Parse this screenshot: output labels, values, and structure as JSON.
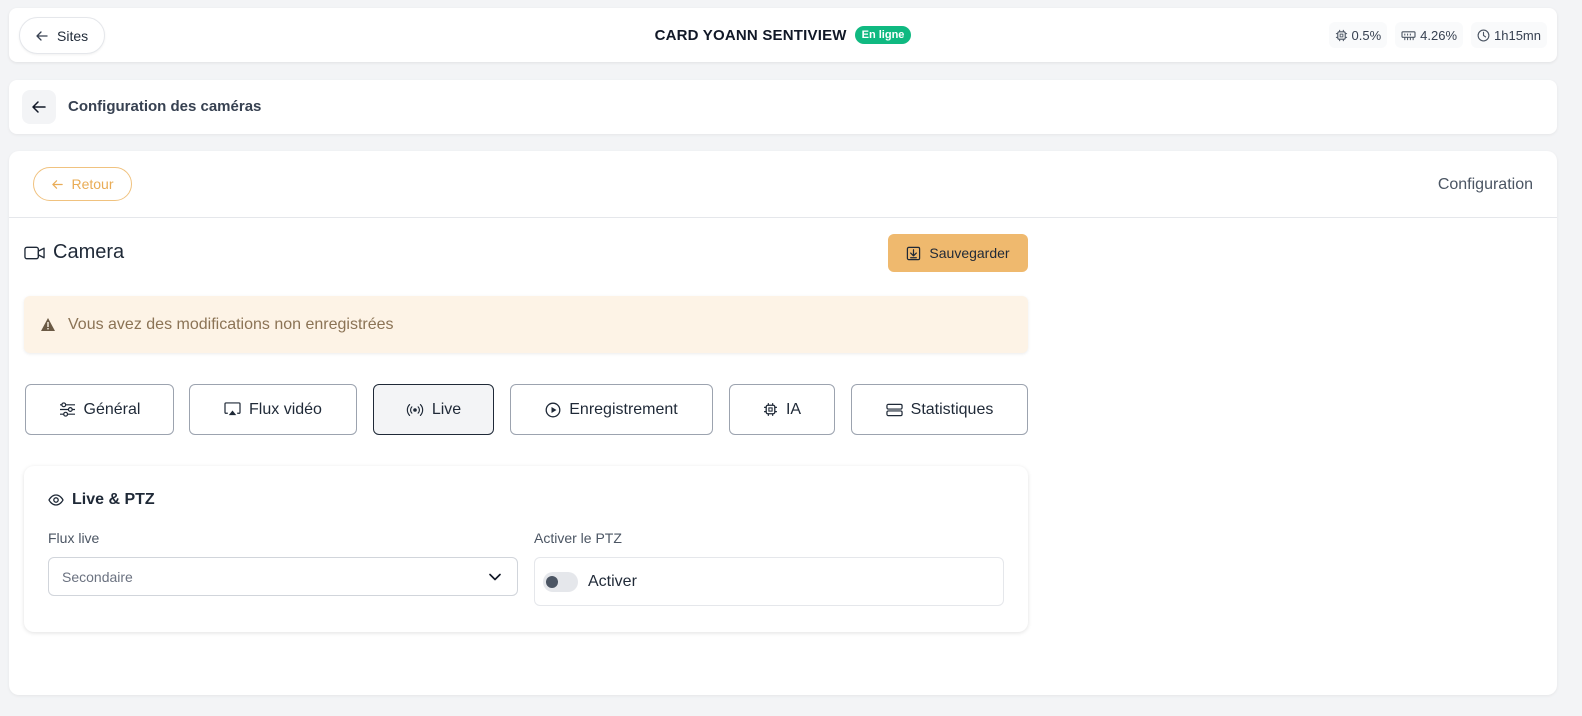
{
  "topbar": {
    "back_label": "Sites",
    "site_name": "CARD YOANN SENTIVIEW",
    "status": "En ligne",
    "cpu": "0.5%",
    "memory": "4.26%",
    "uptime": "1h15mn"
  },
  "subheader": {
    "title": "Configuration des caméras"
  },
  "panel": {
    "retour_label": "Retour",
    "section_label": "Configuration",
    "camera_title": "Camera",
    "save_label": "Sauvegarder",
    "warning": "Vous avez des modifications non enregistrées"
  },
  "tabs": [
    {
      "label": "Général",
      "icon": "sliders-icon"
    },
    {
      "label": "Flux vidéo",
      "icon": "airplay-icon"
    },
    {
      "label": "Live",
      "icon": "broadcast-icon",
      "active": true
    },
    {
      "label": "Enregistrement",
      "icon": "play-circle-icon"
    },
    {
      "label": "IA",
      "icon": "chip-icon"
    },
    {
      "label": "Statistiques",
      "icon": "server-icon"
    }
  ],
  "live_ptz": {
    "title": "Live & PTZ",
    "flux_label": "Flux live",
    "flux_value": "Secondaire",
    "ptz_label": "Activer le PTZ",
    "ptz_toggle_label": "Activer",
    "ptz_enabled": false
  },
  "colors": {
    "accent": "#efb96e",
    "online": "#10b981",
    "warning_bg": "#fdf3e6"
  }
}
